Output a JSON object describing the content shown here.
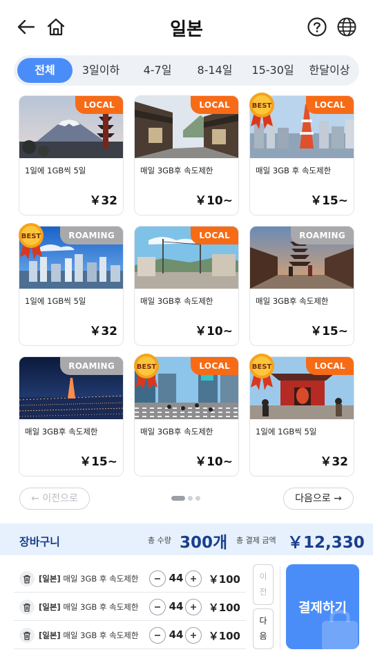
{
  "header": {
    "title": "일본",
    "back_icon": "arrow-left-icon",
    "home_icon": "home-icon",
    "help_icon": "question-circle-icon",
    "language_icon": "globe-icon"
  },
  "tabs": [
    {
      "label": "전체",
      "active": true
    },
    {
      "label": "3일이하",
      "active": false
    },
    {
      "label": "4-7일",
      "active": false
    },
    {
      "label": "8-14일",
      "active": false
    },
    {
      "label": "15-30일",
      "active": false
    },
    {
      "label": "한달이상",
      "active": false
    }
  ],
  "products": [
    {
      "tag": "LOCAL",
      "best": false,
      "desc": "1일에 1GB씩 5일",
      "price": "￥32",
      "scene": "fuji"
    },
    {
      "tag": "LOCAL",
      "best": false,
      "desc": "매일 3GB후 속도제한",
      "price": "￥10~",
      "scene": "oldstreet"
    },
    {
      "tag": "LOCAL",
      "best": true,
      "best_label": "BEST",
      "desc": "매일 3GB 후 속도제한",
      "price": "￥15~",
      "scene": "tokyotower"
    },
    {
      "tag": "ROAMING",
      "best": true,
      "best_label": "BEST",
      "desc": "1일에 1GB씩 5일",
      "price": "￥32",
      "scene": "skyline"
    },
    {
      "tag": "LOCAL",
      "best": false,
      "desc": "매일 3GB후 속도제한",
      "price": "￥10~",
      "scene": "town"
    },
    {
      "tag": "ROAMING",
      "best": false,
      "desc": "매일 3GB후 속도제한",
      "price": "￥15~",
      "scene": "kyoto"
    },
    {
      "tag": "ROAMING",
      "best": false,
      "desc": "매일 3GB후 속도제한",
      "price": "￥15~",
      "scene": "night"
    },
    {
      "tag": "LOCAL",
      "best": true,
      "best_label": "BEST",
      "desc": "매일 3GB후 속도제한",
      "price": "￥10~",
      "scene": "shibuya"
    },
    {
      "tag": "LOCAL",
      "best": true,
      "best_label": "BEST",
      "desc": "1일에 1GB씩 5일",
      "price": "￥32",
      "scene": "temple"
    }
  ],
  "pagination": {
    "prev_label": "이전으로",
    "next_label": "다음으로",
    "prev_enabled": false,
    "pages": 3,
    "current_page": 1
  },
  "cart": {
    "title": "장바구니",
    "qty_label": "총 수량",
    "qty_value": "300개",
    "amount_label": "총 결제 금액",
    "amount_value": "￥12,330",
    "items": [
      {
        "region": "[일본]",
        "name": "매일 3GB 후 속도제한",
        "qty": "44",
        "price": "￥100"
      },
      {
        "region": "[일본]",
        "name": "매일 3GB 후 속도제한",
        "qty": "44",
        "price": "￥100"
      },
      {
        "region": "[일본]",
        "name": "매일 3GB 후 속도제한",
        "qty": "44",
        "price": "￥100"
      }
    ],
    "prev_label": "이전",
    "next_label": "다음",
    "pay_label": "결제하기"
  },
  "colors": {
    "accent": "#4b8df8",
    "local_tag": "#f76b16",
    "roaming_tag": "#a9a9ab",
    "cart_bg": "#e6f1fd",
    "cart_text": "#1a3e8c"
  }
}
